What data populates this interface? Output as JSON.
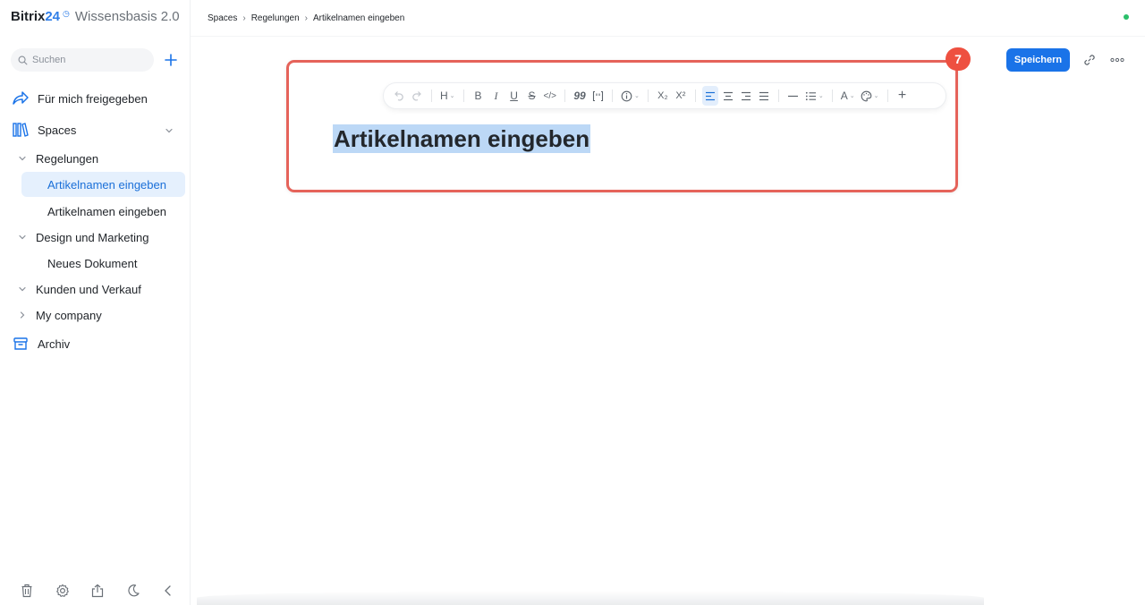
{
  "sidebar": {
    "brand": {
      "name": "Bitrix",
      "number": "24",
      "product": "Wissensbasis 2.0"
    },
    "search": {
      "placeholder": "Suchen"
    },
    "nav": [
      {
        "label": "Für mich freigegeben",
        "icon": "share-icon"
      },
      {
        "label": "Spaces",
        "icon": "library-icon"
      }
    ],
    "tree": [
      {
        "label": "Regelungen",
        "expanded": true,
        "children": [
          {
            "label": "Artikelnamen eingeben",
            "active": true
          },
          {
            "label": "Artikelnamen eingeben",
            "active": false
          }
        ]
      },
      {
        "label": "Design und Marketing",
        "expanded": true,
        "children": [
          {
            "label": "Neues Dokument",
            "active": false
          }
        ]
      },
      {
        "label": "Kunden und Verkauf",
        "expanded": true,
        "children": []
      },
      {
        "label": "My company",
        "expanded": false,
        "children": []
      }
    ],
    "archive": {
      "label": "Archiv"
    },
    "bottom_icons": [
      "trash-icon",
      "gear-icon",
      "export-icon",
      "moon-icon",
      "collapse-icon"
    ]
  },
  "header": {
    "breadcrumb": [
      "Spaces",
      "Regelungen",
      "Artikelnamen eingeben"
    ],
    "save_label": "Speichern",
    "status_color": "#2bbf6a"
  },
  "editor": {
    "step_badge": "7",
    "title": "Artikelnamen eingeben",
    "toolbar": {
      "heading": "H",
      "bold": "B",
      "italic": "I",
      "underline": "U",
      "strike": "S",
      "code": "</>",
      "quote": "99",
      "subscript": "X₂",
      "superscript": "X²",
      "text_color": "A",
      "insert": "+"
    }
  },
  "colors": {
    "accent": "#1a73e8",
    "highlight": "#e5635a",
    "selection": "#bcd8f6"
  }
}
